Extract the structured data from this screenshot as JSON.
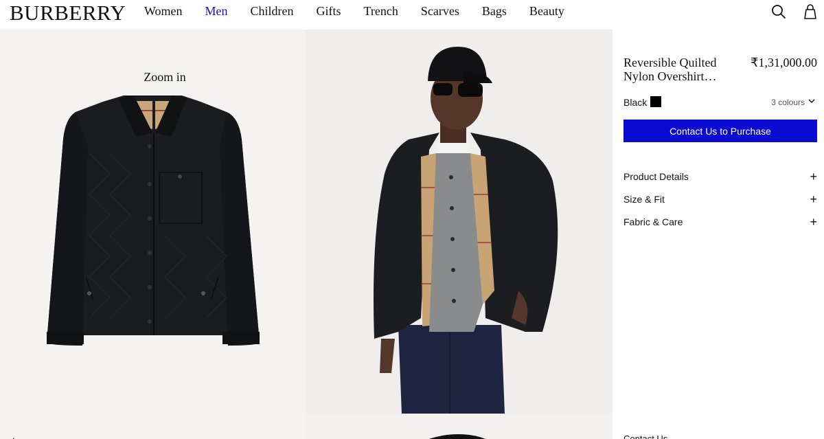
{
  "header": {
    "logo": "BURBERRY",
    "nav": [
      {
        "label": "Women",
        "active": false
      },
      {
        "label": "Men",
        "active": true
      },
      {
        "label": "Children",
        "active": false
      },
      {
        "label": "Gifts",
        "active": false
      },
      {
        "label": "Trench",
        "active": false
      },
      {
        "label": "Scarves",
        "active": false
      },
      {
        "label": "Bags",
        "active": false
      },
      {
        "label": "Beauty",
        "active": false
      }
    ],
    "icons": [
      "search-icon",
      "shopping-bag-icon"
    ]
  },
  "gallery": {
    "zoom_label": "Zoom in"
  },
  "product": {
    "title": "Reversible Quilted Nylon Overshirt…",
    "price": "₹1,31,000.00",
    "color_name": "Black",
    "swatch_color": "#000000",
    "colours_label": "3 colours",
    "cta_label": "Contact Us to Purchase",
    "cta_color": "#0a0ad0",
    "accordion": [
      {
        "label": "Product Details"
      },
      {
        "label": "Size & Fit"
      },
      {
        "label": "Fabric & Care"
      }
    ],
    "contact_label": "Contact Us"
  },
  "colors": {
    "accent_nav": "#1d0fb8",
    "gallery_bg": "#f4f3f2"
  }
}
